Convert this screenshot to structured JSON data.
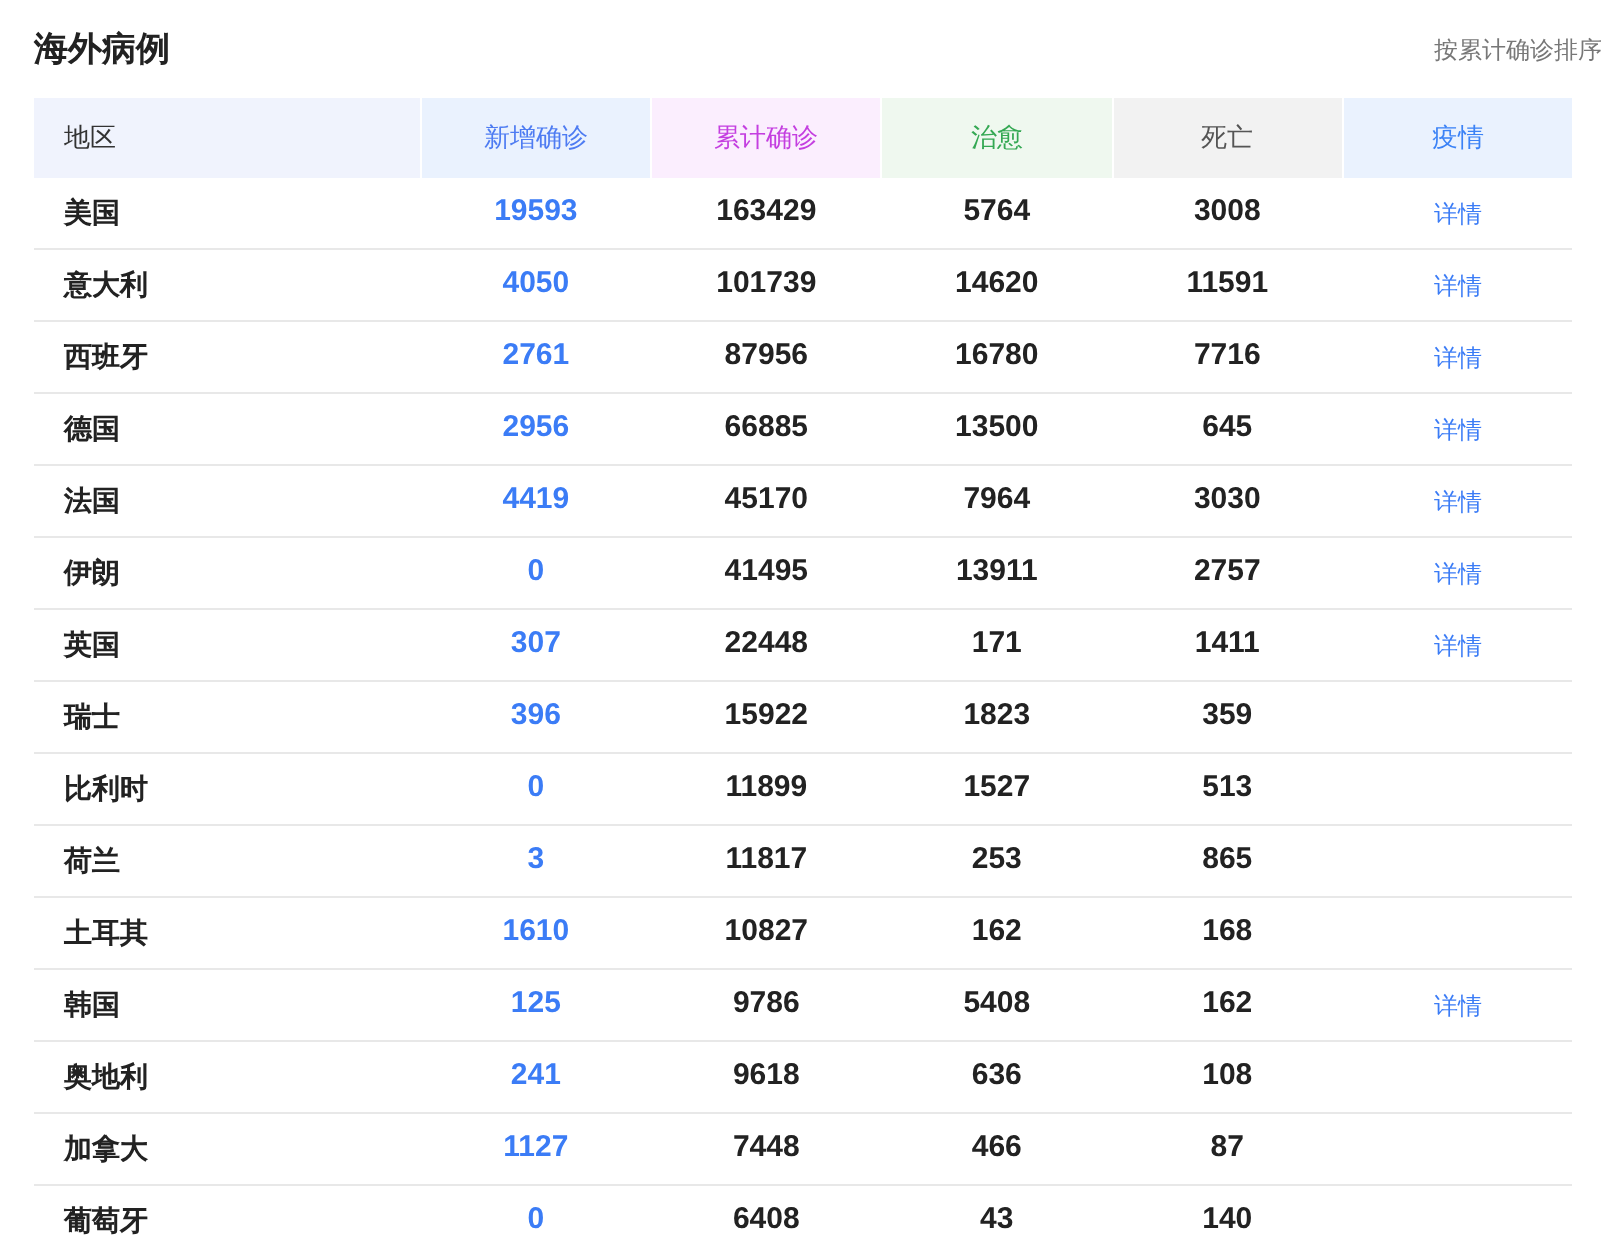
{
  "title": "海外病例",
  "sort_link": "按累计确诊排序",
  "columns": [
    {
      "label": "地区",
      "color": "#333333"
    },
    {
      "label": "新增确诊",
      "color": "#4e7cf2"
    },
    {
      "label": "累计确诊",
      "color": "#c43fe0"
    },
    {
      "label": "治愈",
      "color": "#34a853"
    },
    {
      "label": "死亡",
      "color": "#555555"
    },
    {
      "label": "疫情",
      "color": "#3b82f6"
    }
  ],
  "rows": [
    {
      "region": "美国",
      "new": "19593",
      "total": "163429",
      "cured": "5764",
      "dead": "3008",
      "detail": "详情"
    },
    {
      "region": "意大利",
      "new": "4050",
      "total": "101739",
      "cured": "14620",
      "dead": "11591",
      "detail": "详情"
    },
    {
      "region": "西班牙",
      "new": "2761",
      "total": "87956",
      "cured": "16780",
      "dead": "7716",
      "detail": "详情"
    },
    {
      "region": "德国",
      "new": "2956",
      "total": "66885",
      "cured": "13500",
      "dead": "645",
      "detail": "详情"
    },
    {
      "region": "法国",
      "new": "4419",
      "total": "45170",
      "cured": "7964",
      "dead": "3030",
      "detail": "详情"
    },
    {
      "region": "伊朗",
      "new": "0",
      "total": "41495",
      "cured": "13911",
      "dead": "2757",
      "detail": "详情"
    },
    {
      "region": "英国",
      "new": "307",
      "total": "22448",
      "cured": "171",
      "dead": "1411",
      "detail": "详情"
    },
    {
      "region": "瑞士",
      "new": "396",
      "total": "15922",
      "cured": "1823",
      "dead": "359"
    },
    {
      "region": "比利时",
      "new": "0",
      "total": "11899",
      "cured": "1527",
      "dead": "513"
    },
    {
      "region": "荷兰",
      "new": "3",
      "total": "11817",
      "cured": "253",
      "dead": "865"
    },
    {
      "region": "土耳其",
      "new": "1610",
      "total": "10827",
      "cured": "162",
      "dead": "168"
    },
    {
      "region": "韩国",
      "new": "125",
      "total": "9786",
      "cured": "5408",
      "dead": "162",
      "detail": "详情"
    },
    {
      "region": "奥地利",
      "new": "241",
      "total": "9618",
      "cured": "636",
      "dead": "108"
    },
    {
      "region": "加拿大",
      "new": "1127",
      "total": "7448",
      "cured": "466",
      "dead": "87"
    },
    {
      "region": "葡萄牙",
      "new": "0",
      "total": "6408",
      "cured": "43",
      "dead": "140"
    }
  ]
}
